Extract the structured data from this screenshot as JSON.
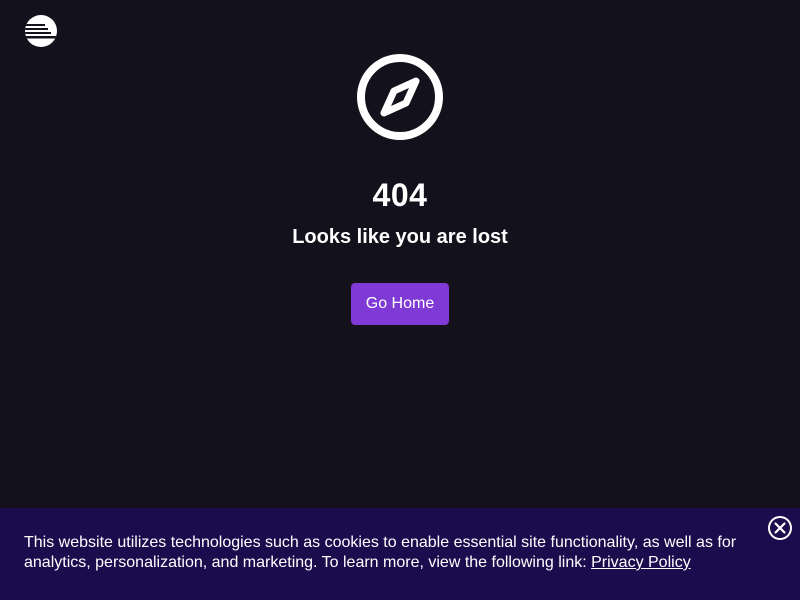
{
  "header": {
    "logo_icon": "striped-globe-logo-icon"
  },
  "error": {
    "icon": "compass-icon",
    "code": "404",
    "message": "Looks like you are lost"
  },
  "actions": {
    "home_label": "Go Home"
  },
  "cookie_banner": {
    "text": "This website utilizes technologies such as cookies to enable essential site functionality, as well as for analytics, personalization, and marketing. To learn more, view the following link: ",
    "link_label": "Privacy Policy",
    "close_icon": "close-circle-icon"
  },
  "colors": {
    "background": "#13111c",
    "button": "#7f3ad6",
    "banner": "#1b0d4d",
    "text": "#ffffff"
  }
}
